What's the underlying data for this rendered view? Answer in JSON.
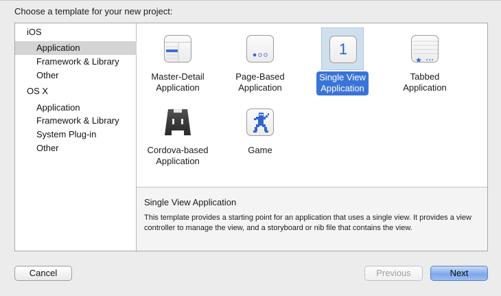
{
  "heading": "Choose a template for your new project:",
  "sidebar": {
    "items": [
      {
        "label": "iOS",
        "kind": "group",
        "selected": false
      },
      {
        "label": "Application",
        "kind": "sub",
        "selected": true
      },
      {
        "label": "Framework & Library",
        "kind": "sub",
        "selected": false
      },
      {
        "label": "Other",
        "kind": "sub",
        "selected": false
      },
      {
        "label": "OS X",
        "kind": "group",
        "selected": false
      },
      {
        "label": "Application",
        "kind": "sub",
        "selected": false
      },
      {
        "label": "Framework & Library",
        "kind": "sub",
        "selected": false
      },
      {
        "label": "System Plug-in",
        "kind": "sub",
        "selected": false
      },
      {
        "label": "Other",
        "kind": "sub",
        "selected": false
      }
    ]
  },
  "templates": [
    {
      "line1": "Master-Detail",
      "line2": "Application",
      "icon": "master-detail-icon",
      "selected": false
    },
    {
      "line1": "Page-Based",
      "line2": "Application",
      "icon": "page-based-icon",
      "selected": false
    },
    {
      "line1": "Single View",
      "line2": "Application",
      "icon": "single-view-icon",
      "selected": true
    },
    {
      "line1": "Tabbed",
      "line2": "Application",
      "icon": "tabbed-icon",
      "selected": false
    },
    {
      "line1": "Cordova-based",
      "line2": "Application",
      "icon": "cordova-icon",
      "selected": false
    },
    {
      "line1": "Game",
      "line2": "",
      "icon": "game-icon",
      "selected": false
    }
  ],
  "single_view_glyph": "1",
  "description": {
    "title": "Single View Application",
    "text": "This template provides a starting point for an application that uses a single view. It provides a view controller to manage the view, and a storyboard or nib file that contains the view."
  },
  "buttons": {
    "cancel": "Cancel",
    "previous": "Previous",
    "next": "Next"
  },
  "colors": {
    "selection_blue": "#3b74d8",
    "next_button": "#7ea8ea"
  }
}
